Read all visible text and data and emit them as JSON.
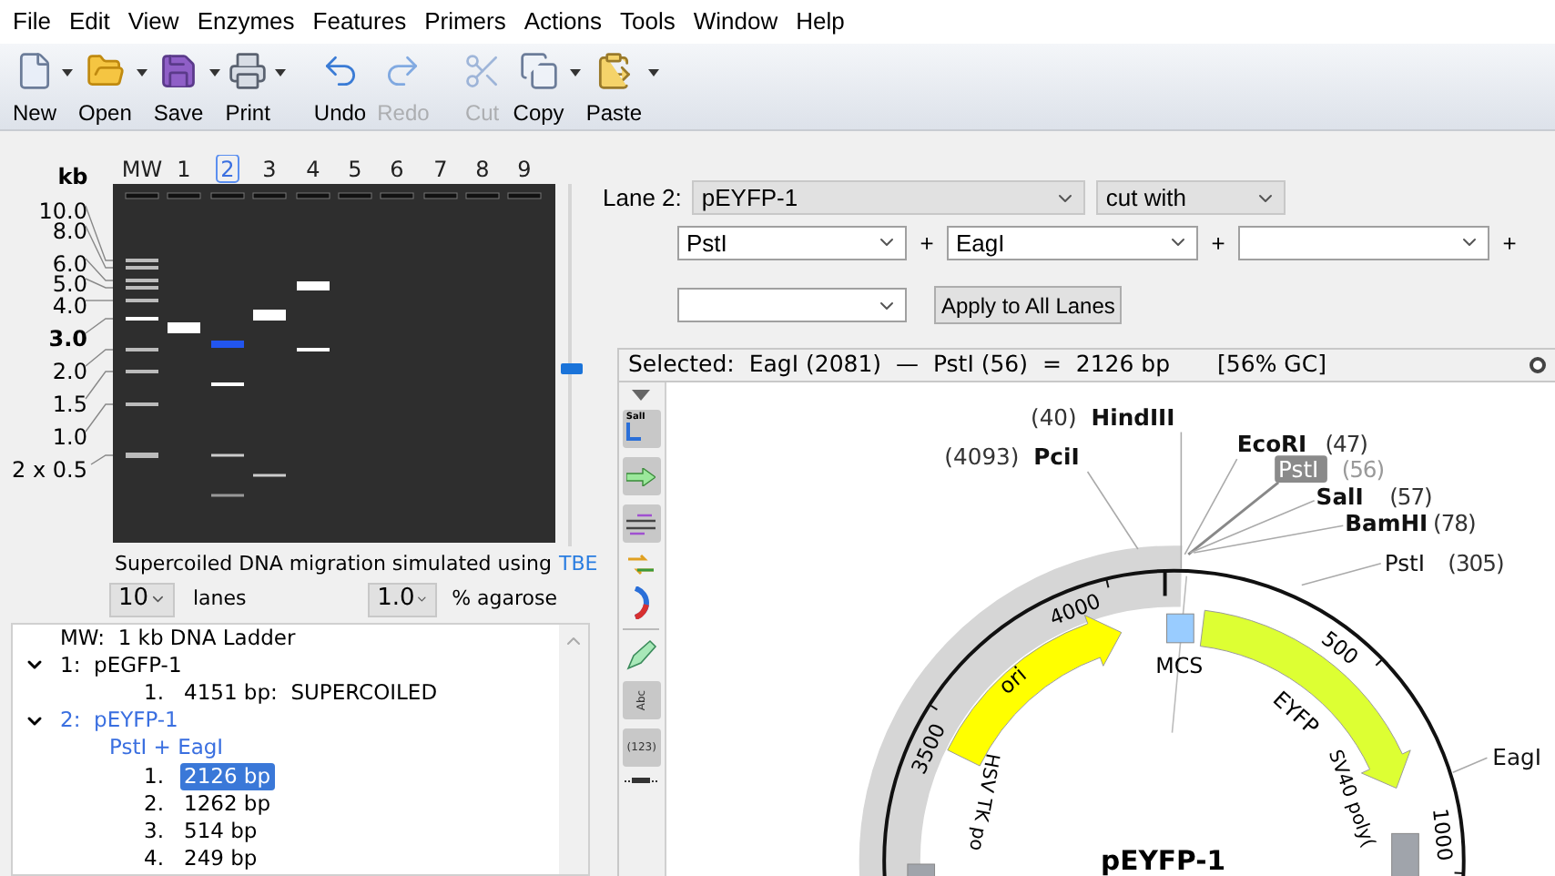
{
  "menu": [
    "File",
    "Edit",
    "View",
    "Enzymes",
    "Features",
    "Primers",
    "Actions",
    "Tools",
    "Window",
    "Help"
  ],
  "toolbar": [
    {
      "label": "New",
      "caret": true,
      "disabled": false
    },
    {
      "label": "Open",
      "caret": true,
      "disabled": false
    },
    {
      "label": "Save",
      "caret": true,
      "disabled": false
    },
    {
      "label": "Print",
      "caret": true,
      "disabled": false
    },
    {
      "label": "Undo",
      "caret": false,
      "disabled": false
    },
    {
      "label": "Redo",
      "caret": false,
      "disabled": true
    },
    {
      "label": "Cut",
      "caret": false,
      "disabled": true
    },
    {
      "label": "Copy",
      "caret": true,
      "disabled": false
    },
    {
      "label": "Paste",
      "caret": true,
      "disabled": false
    }
  ],
  "gel": {
    "kb_title": "kb",
    "lanes": [
      {
        "label": "MW",
        "selected": false
      },
      {
        "label": "1",
        "selected": false
      },
      {
        "label": "2",
        "selected": true
      },
      {
        "label": "3",
        "selected": false
      },
      {
        "label": "4",
        "selected": false
      },
      {
        "label": "5",
        "selected": false
      },
      {
        "label": "6",
        "selected": false
      },
      {
        "label": "7",
        "selected": false
      },
      {
        "label": "8",
        "selected": false
      },
      {
        "label": "9",
        "selected": false
      }
    ],
    "size_markers": [
      {
        "label": "10.0",
        "bold": false
      },
      {
        "label": "8.0",
        "bold": false
      },
      {
        "label": "6.0",
        "bold": false
      },
      {
        "label": "5.0",
        "bold": false
      },
      {
        "label": "4.0",
        "bold": false
      },
      {
        "label": "3.0",
        "bold": true
      },
      {
        "label": "2.0",
        "bold": false
      },
      {
        "label": "1.5",
        "bold": false
      },
      {
        "label": "1.0",
        "bold": false
      },
      {
        "label": "2 x 0.5",
        "bold": false
      }
    ],
    "slider": {
      "level": 0.51
    },
    "caption": "Supercoiled DNA migration simulated using",
    "buffer_link": "TBE",
    "lanes_select": "10",
    "lanes_label": "lanes",
    "agarose_select": "1.0",
    "agarose_label": "% agarose"
  },
  "lane_tree": [
    {
      "number": "MW:",
      "name": "1 kb DNA Ladder",
      "selected": false
    },
    {
      "number": "1:",
      "name": "pEGFP-1",
      "expanded": true,
      "selected": false,
      "children": [
        {
          "number": "1.",
          "text": "4151 bp:  SUPERCOILED",
          "selected": false
        }
      ]
    },
    {
      "number": "2:",
      "name": "pEYFP-1",
      "expanded": true,
      "selected": true,
      "digest": "PstI + EagI",
      "children": [
        {
          "number": "1.",
          "text": "2126 bp",
          "selected": true
        },
        {
          "number": "2.",
          "text": "1262 bp",
          "selected": false
        },
        {
          "number": "3.",
          "text": "514 bp",
          "selected": false
        },
        {
          "number": "4.",
          "text": "249 bp",
          "selected": false
        }
      ]
    }
  ],
  "lane_editor": {
    "label": "Lane 2:",
    "sequence": "pEYFP-1",
    "mode": "cut with",
    "enzyme_slots": [
      {
        "value": "PstI",
        "joiner": "+"
      },
      {
        "value": "EagI",
        "joiner": "+"
      },
      {
        "joiner": "+"
      }
    ],
    "apply_button": "Apply to All Lanes"
  },
  "map": {
    "selection_info": "Selected:  EagI (2081)  —  PstI (56)  =  2126 bp",
    "gc": "[56% GC]",
    "tools": {
      "enzyme_tool": "SalI",
      "text_tool": "Abc",
      "number_tool": "(123)"
    },
    "title": "pEYFP-1",
    "sites": [
      {
        "name": "HindIII",
        "position": "(40)",
        "bold": true,
        "selected": false
      },
      {
        "name": "PciI",
        "position": "(4093)",
        "bold": true,
        "selected": false
      },
      {
        "name": "EcoRI",
        "position": "(47)",
        "bold": true,
        "selected": false
      },
      {
        "name": "PstI",
        "position": "(56)",
        "bold": false,
        "selected": true
      },
      {
        "name": "SalI",
        "position": "(57)",
        "bold": true,
        "selected": false
      },
      {
        "name": "BamHI",
        "position": "(78)",
        "bold": true,
        "selected": false
      },
      {
        "name": "PstI",
        "position": "(305)",
        "bold": false,
        "selected": false
      },
      {
        "name": "EagI",
        "bold": false,
        "selected": false
      }
    ],
    "ticks": [
      "4000",
      "3500",
      "500",
      "1000"
    ],
    "features": [
      {
        "kind": "arrow",
        "label": "ori",
        "color": "#ffff00"
      },
      {
        "kind": "box",
        "label": "MCS",
        "color": "#99ccff"
      },
      {
        "kind": "arrow",
        "label": "EYFP",
        "color": "#ddff33"
      },
      {
        "kind": "box",
        "label": "SV40 poly(",
        "color": "#a0a4ab"
      },
      {
        "kind": "box",
        "label": "HSV TK po",
        "color": "#a0a4ab"
      }
    ]
  }
}
